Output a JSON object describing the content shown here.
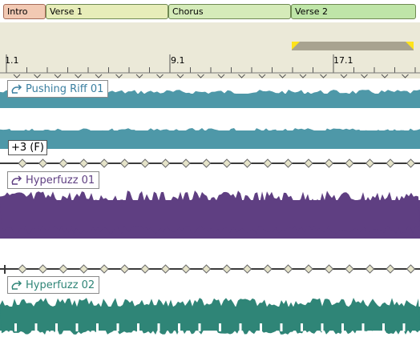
{
  "sections": [
    {
      "label": "Intro",
      "color": "#f2c9b3"
    },
    {
      "label": "Verse 1",
      "color": "#e7edb9"
    },
    {
      "label": "Chorus",
      "color": "#d5ebb9"
    },
    {
      "label": "Verse 2",
      "color": "#bfe5a8"
    }
  ],
  "ruler": {
    "labels": [
      "1.1",
      "9.1",
      "17.1"
    ]
  },
  "tracks": [
    {
      "clip_name": "Pushing Riff 01",
      "color": "#4e98a8"
    },
    {
      "clip_name": "Hyperfuzz 01",
      "color": "#5f3f82",
      "transpose": "+3 (F)"
    },
    {
      "clip_name": "Hyperfuzz 02",
      "color": "#2f8577"
    }
  ],
  "colors": {
    "ruler_bg": "#ebe9d8",
    "loop": "#a8a390",
    "loop_flag": "#ffe31a",
    "envelope_node": "#e5e3c9"
  }
}
